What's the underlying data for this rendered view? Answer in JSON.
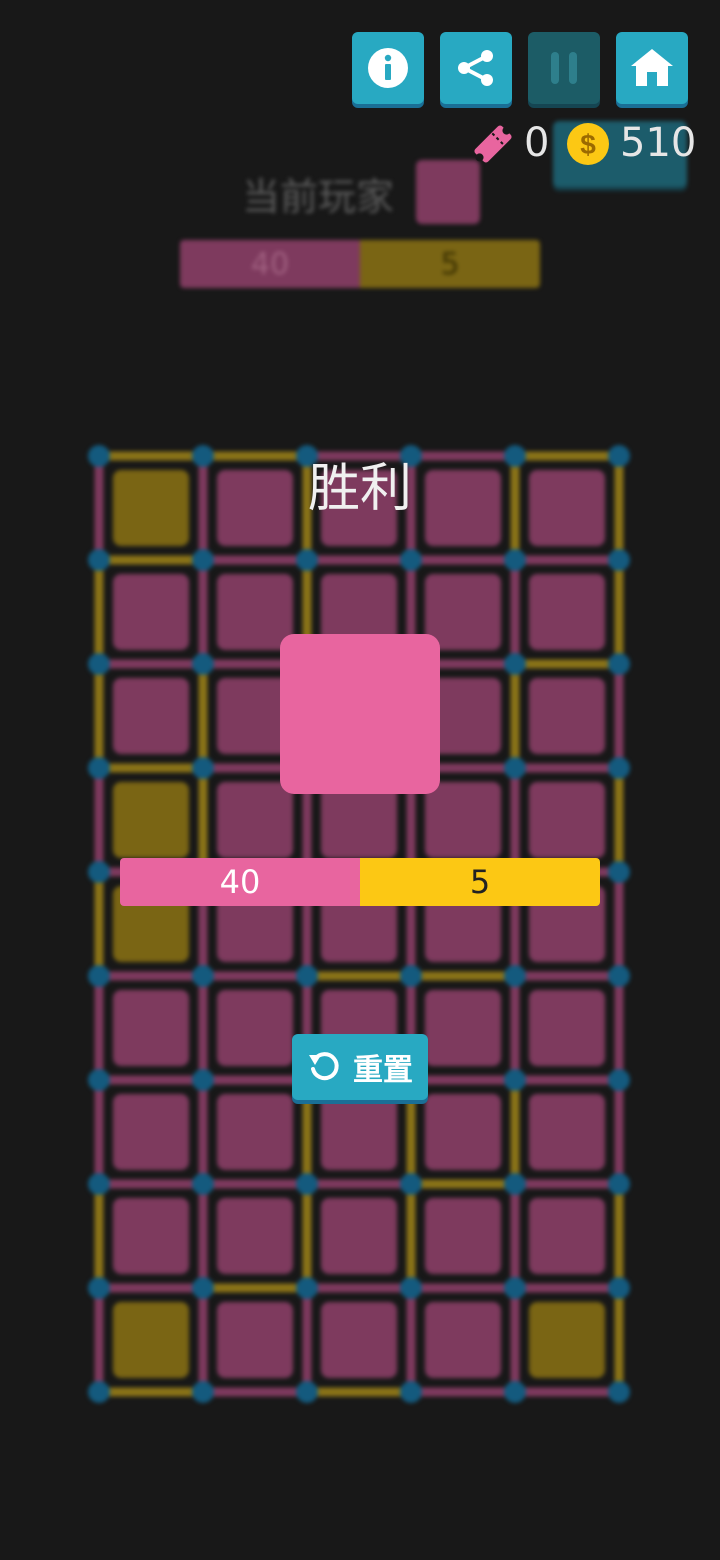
{
  "topbar": {
    "buttons": [
      {
        "name": "info-button",
        "icon": "info-icon"
      },
      {
        "name": "share-button",
        "icon": "share-icon"
      },
      {
        "name": "pause-button",
        "icon": "pause-icon"
      },
      {
        "name": "home-button",
        "icon": "home-icon"
      }
    ],
    "tickets": "0",
    "coins": "510"
  },
  "background": {
    "current_player_label": "当前玩家",
    "score_pink": "40",
    "score_yellow": "5"
  },
  "result": {
    "title": "胜利",
    "winner_color": "#e8659f",
    "score_pink": "40",
    "score_yellow": "5",
    "reset_label": "重置"
  },
  "board": {
    "cols": 5,
    "rows": 9,
    "pink_color": "#7e3a5e",
    "yellow_color": "#7a6514",
    "dot_color": "#145a7e",
    "yellow_cells": [
      [
        0,
        0
      ],
      [
        0,
        3
      ],
      [
        0,
        4
      ],
      [
        0,
        8
      ],
      [
        4,
        8
      ]
    ],
    "yellow_h_edges": [
      [
        0,
        0
      ],
      [
        1,
        0
      ],
      [
        4,
        0
      ],
      [
        0,
        1
      ],
      [
        4,
        2
      ],
      [
        0,
        3
      ],
      [
        2,
        5
      ],
      [
        3,
        5
      ],
      [
        3,
        7
      ],
      [
        1,
        8
      ],
      [
        0,
        9
      ],
      [
        2,
        9
      ]
    ],
    "pink_h_edges": [
      [
        3,
        0
      ]
    ],
    "yellow_v_edges": [
      [
        2,
        0
      ],
      [
        4,
        0
      ],
      [
        5,
        0
      ],
      [
        0,
        1
      ],
      [
        2,
        1
      ],
      [
        5,
        1
      ],
      [
        0,
        2
      ],
      [
        1,
        2
      ],
      [
        4,
        2
      ],
      [
        1,
        3
      ],
      [
        5,
        3
      ],
      [
        0,
        4
      ],
      [
        2,
        6
      ],
      [
        3,
        6
      ],
      [
        4,
        6
      ],
      [
        3,
        7
      ],
      [
        0,
        7
      ],
      [
        2,
        7
      ],
      [
        5,
        7
      ],
      [
        5,
        8
      ]
    ]
  },
  "colors": {
    "accent": "#28a9c2",
    "pink": "#e8659f",
    "yellow": "#fcc814",
    "background": "#181818"
  }
}
